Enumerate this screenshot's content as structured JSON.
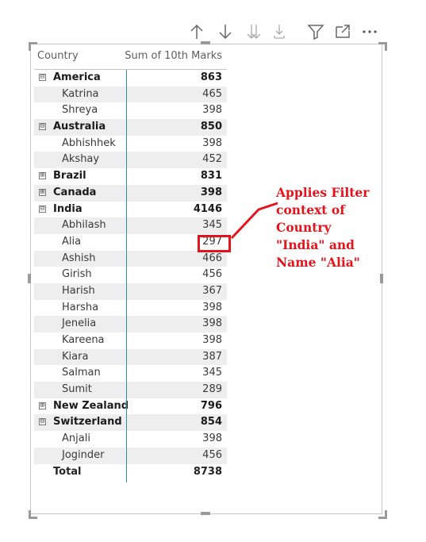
{
  "toolbar": {
    "icons": [
      "arrow-up-icon",
      "arrow-down-icon",
      "double-arrow-down-icon",
      "expand-down-icon",
      "filter-icon",
      "focus-mode-icon",
      "more-options-icon"
    ]
  },
  "matrix": {
    "header": {
      "col1": "Country",
      "col2": "Sum of 10th Marks"
    },
    "rows": [
      {
        "type": "group",
        "expander": "⊟",
        "label": "America",
        "value": "863"
      },
      {
        "type": "child",
        "label": "Katrina",
        "value": "465"
      },
      {
        "type": "child",
        "label": "Shreya",
        "value": "398"
      },
      {
        "type": "group",
        "expander": "⊟",
        "label": "Australia",
        "value": "850"
      },
      {
        "type": "child",
        "label": "Abhishhek",
        "value": "398"
      },
      {
        "type": "child",
        "label": "Akshay",
        "value": "452"
      },
      {
        "type": "group",
        "expander": "⊞",
        "label": "Brazil",
        "value": "831"
      },
      {
        "type": "group",
        "expander": "⊞",
        "label": "Canada",
        "value": "398"
      },
      {
        "type": "group",
        "expander": "⊟",
        "label": "India",
        "value": "4146"
      },
      {
        "type": "child",
        "label": "Abhilash",
        "value": "345"
      },
      {
        "type": "child",
        "label": "Alia",
        "value": "297"
      },
      {
        "type": "child",
        "label": "Ashish",
        "value": "466"
      },
      {
        "type": "child",
        "label": "Girish",
        "value": "456"
      },
      {
        "type": "child",
        "label": "Harish",
        "value": "367"
      },
      {
        "type": "child",
        "label": "Harsha",
        "value": "398"
      },
      {
        "type": "child",
        "label": "Jenelia",
        "value": "398"
      },
      {
        "type": "child",
        "label": "Kareena",
        "value": "398"
      },
      {
        "type": "child",
        "label": "Kiara",
        "value": "387"
      },
      {
        "type": "child",
        "label": "Salman",
        "value": "345"
      },
      {
        "type": "child",
        "label": "Sumit",
        "value": "289"
      },
      {
        "type": "group",
        "expander": "⊞",
        "label": "New Zealand",
        "value": "796"
      },
      {
        "type": "group",
        "expander": "⊟",
        "label": "Switzerland",
        "value": "854"
      },
      {
        "type": "child",
        "label": "Anjali",
        "value": "398"
      },
      {
        "type": "child",
        "label": "Joginder",
        "value": "456"
      },
      {
        "type": "total",
        "label": "Total",
        "value": "8738"
      }
    ]
  },
  "annotation": {
    "lines": [
      "Applies Filter",
      "context of",
      "Country",
      "\"India\" and",
      "Name \"Alia\""
    ],
    "color": "#e1151b"
  },
  "colors": {
    "divider": "#2b8fa8",
    "alt_row": "#eeeeee"
  }
}
